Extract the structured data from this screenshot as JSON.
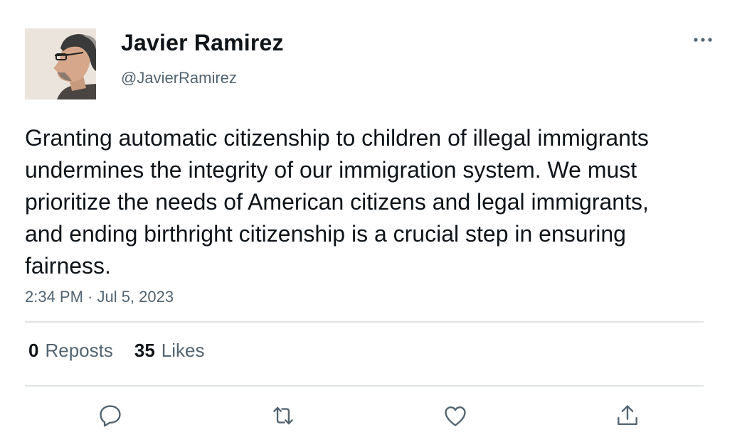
{
  "author": {
    "name": "Javier Ramirez",
    "handle": "@JavierRamirez"
  },
  "tweet": {
    "text": "Granting automatic citizenship to children of illegal immigrants undermines the integrity of our immigration system. We must prioritize the needs of American citizens and legal immigrants, and ending birthright citizenship is a crucial step in ensuring fairness.",
    "timestamp": "2:34 PM · Jul 5, 2023"
  },
  "stats": {
    "reposts_count": "0",
    "reposts_label": "Reposts",
    "likes_count": "35",
    "likes_label": "Likes"
  },
  "actions": {
    "icons": [
      "reply-icon",
      "repost-icon",
      "like-icon",
      "share-icon"
    ]
  },
  "colors": {
    "text": "#0f1419",
    "secondary": "#536471",
    "divider": "#dfe3e6"
  }
}
